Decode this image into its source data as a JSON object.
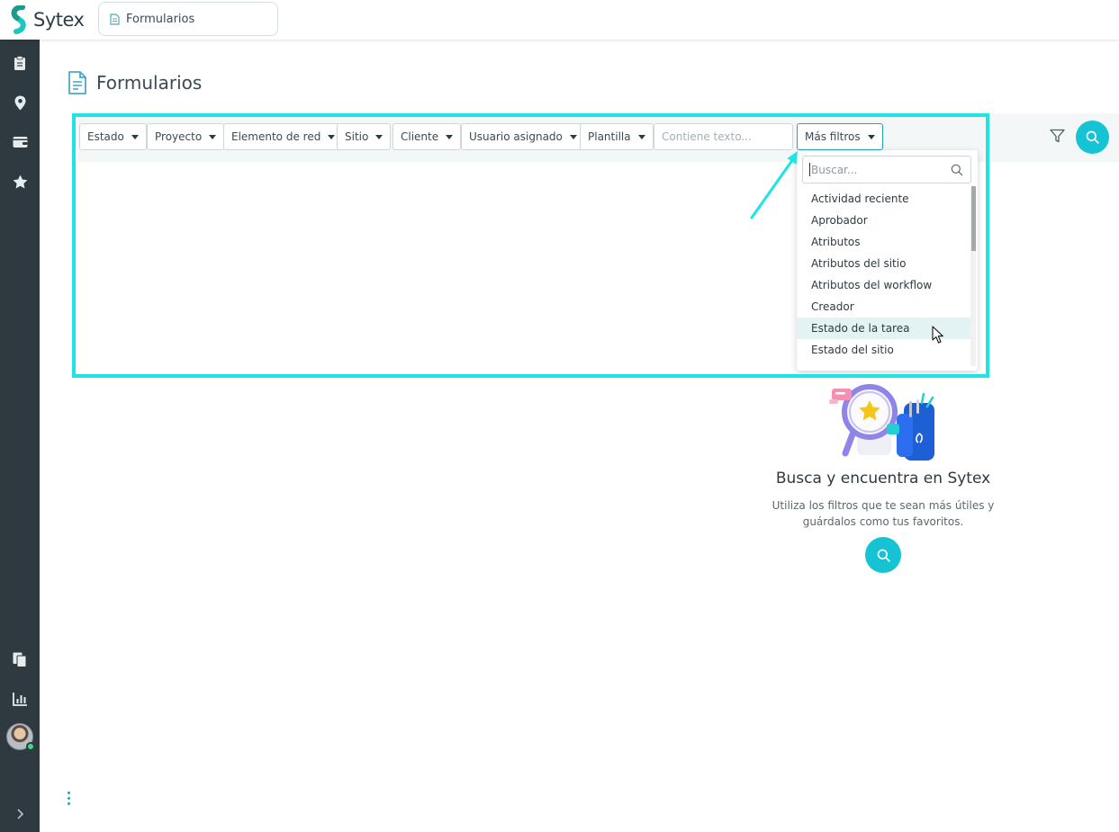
{
  "app": {
    "name": "Sytex",
    "brand_color": "#15c3d3",
    "sidebar_color": "#2e3a3f"
  },
  "topbar": {
    "tab_label": "Formularios",
    "tab_icon": "document-icon"
  },
  "sidebar": {
    "items": [
      {
        "name": "clipboard-icon"
      },
      {
        "name": "location-pin-icon"
      },
      {
        "name": "wallet-icon"
      },
      {
        "name": "star-icon"
      },
      {
        "name": "files-icon"
      },
      {
        "name": "chart-icon"
      },
      {
        "name": "gear-icon"
      },
      {
        "name": "avatar"
      },
      {
        "name": "chevron-right-icon"
      }
    ]
  },
  "page": {
    "title": "Formularios"
  },
  "filters": {
    "chips": [
      "Estado",
      "Proyecto",
      "Elemento de red",
      "Sitio",
      "Cliente",
      "Usuario asignado",
      "Plantilla"
    ],
    "text_placeholder": "Contiene texto...",
    "more_label": "Más filtros"
  },
  "dropdown": {
    "search_placeholder": "Buscar...",
    "items": [
      "Actividad reciente",
      "Aprobador",
      "Atributos",
      "Atributos del sitio",
      "Atributos del workflow",
      "Creador",
      "Estado de la tarea",
      "Estado del sitio"
    ],
    "hovered_item": "Estado de la tarea"
  },
  "empty_state": {
    "title": "Busca y encuentra en Sytex",
    "description": "Utiliza los filtros que te sean más útiles y guárdalos como tus favoritos."
  },
  "annotation": {
    "highlight_color": "#1fe4e4"
  }
}
